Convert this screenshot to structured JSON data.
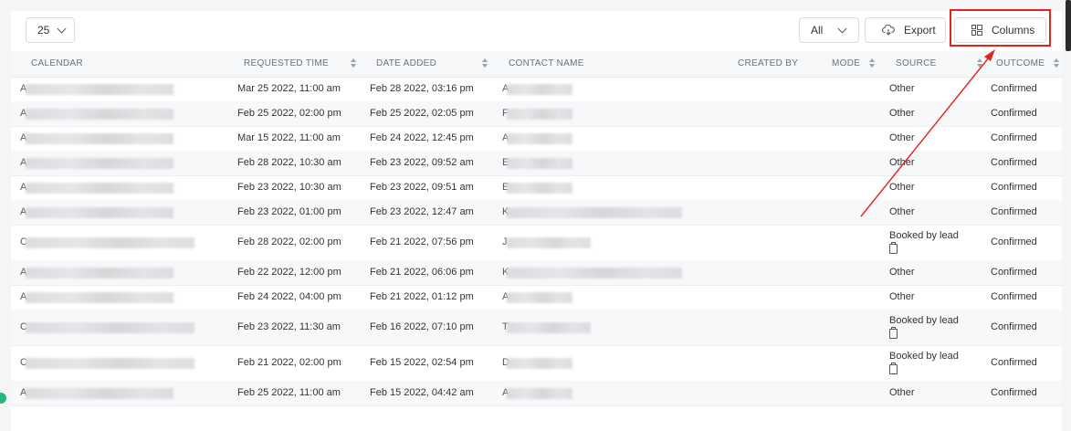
{
  "toolbar": {
    "page_size": "25",
    "filter_value": "All",
    "export_label": "Export",
    "columns_label": "Columns"
  },
  "columns": {
    "calendar": "CALENDAR",
    "requested_time": "REQUESTED TIME",
    "date_added": "DATE ADDED",
    "contact_name": "CONTACT NAME",
    "created_by": "CREATED BY",
    "mode": "MODE",
    "source": "SOURCE",
    "outcome": "OUTCOME"
  },
  "rows": [
    {
      "calendar_initial": "A",
      "requested_time": "Mar 25 2022, 11:00 am",
      "date_added": "Feb 28 2022, 03:16 pm",
      "contact_initial": "A",
      "source": "Other",
      "outcome": "Confirmed"
    },
    {
      "calendar_initial": "A",
      "requested_time": "Feb 25 2022, 02:00 pm",
      "date_added": "Feb 25 2022, 02:05 pm",
      "contact_initial": "F",
      "source": "Other",
      "outcome": "Confirmed"
    },
    {
      "calendar_initial": "A",
      "requested_time": "Mar 15 2022, 11:00 am",
      "date_added": "Feb 24 2022, 12:45 pm",
      "contact_initial": "A",
      "source": "Other",
      "outcome": "Confirmed"
    },
    {
      "calendar_initial": "A",
      "requested_time": "Feb 28 2022, 10:30 am",
      "date_added": "Feb 23 2022, 09:52 am",
      "contact_initial": "E",
      "source": "Other",
      "outcome": "Confirmed"
    },
    {
      "calendar_initial": "A",
      "requested_time": "Feb 23 2022, 10:30 am",
      "date_added": "Feb 23 2022, 09:51 am",
      "contact_initial": "E",
      "source": "Other",
      "outcome": "Confirmed"
    },
    {
      "calendar_initial": "A",
      "requested_time": "Feb 23 2022, 01:00 pm",
      "date_added": "Feb 23 2022, 12:47 am",
      "contact_initial": "K",
      "source": "Other",
      "outcome": "Confirmed"
    },
    {
      "calendar_initial": "C",
      "requested_time": "Feb 28 2022, 02:00 pm",
      "date_added": "Feb 21 2022, 07:56 pm",
      "contact_initial": "J",
      "source": "Booked by lead",
      "outcome": "Confirmed"
    },
    {
      "calendar_initial": "A",
      "requested_time": "Feb 22 2022, 12:00 pm",
      "date_added": "Feb 21 2022, 06:06 pm",
      "contact_initial": "K",
      "source": "Other",
      "outcome": "Confirmed"
    },
    {
      "calendar_initial": "A",
      "requested_time": "Feb 24 2022, 04:00 pm",
      "date_added": "Feb 21 2022, 01:12 pm",
      "contact_initial": "A",
      "source": "Other",
      "outcome": "Confirmed"
    },
    {
      "calendar_initial": "C",
      "requested_time": "Feb 23 2022, 11:30 am",
      "date_added": "Feb 16 2022, 07:10 pm",
      "contact_initial": "T",
      "source": "Booked by lead",
      "outcome": "Confirmed"
    },
    {
      "calendar_initial": "C",
      "requested_time": "Feb 21 2022, 02:00 pm",
      "date_added": "Feb 15 2022, 02:54 pm",
      "contact_initial": "D",
      "source": "Booked by lead",
      "outcome": "Confirmed"
    },
    {
      "calendar_initial": "A",
      "requested_time": "Feb 25 2022, 11:00 am",
      "date_added": "Feb 15 2022, 04:42 am",
      "contact_initial": "A",
      "source": "Other",
      "outcome": "Confirmed"
    }
  ]
}
